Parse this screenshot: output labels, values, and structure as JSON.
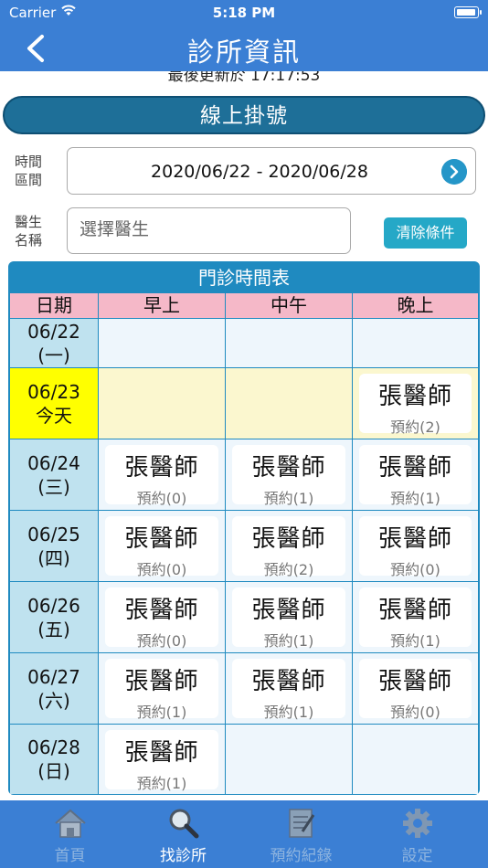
{
  "status_bar": {
    "carrier": "Carrier",
    "time": "5:18 PM"
  },
  "nav": {
    "title": "診所資訊"
  },
  "last_updated": "最後更新於 17:17:53",
  "banner": "線上掛號",
  "filters": {
    "period_label": "時間\n區間",
    "period_value": "2020/06/22 - 2020/06/28",
    "doctor_label": "醫生\n名稱",
    "doctor_placeholder": "選擇醫生",
    "clear_label": "清除條件"
  },
  "schedule": {
    "title": "門診時間表",
    "headers": [
      "日期",
      "早上",
      "中午",
      "晚上"
    ],
    "rows": [
      {
        "date": "06/22",
        "day": "(一)",
        "slots": [
          null,
          null,
          null
        ]
      },
      {
        "date": "06/23",
        "day": "今天",
        "today": true,
        "slots": [
          null,
          null,
          {
            "doctor": "張醫師",
            "booked": "預約(2)"
          }
        ]
      },
      {
        "date": "06/24",
        "day": "(三)",
        "slots": [
          {
            "doctor": "張醫師",
            "booked": "預約(0)"
          },
          {
            "doctor": "張醫師",
            "booked": "預約(1)"
          },
          {
            "doctor": "張醫師",
            "booked": "預約(1)"
          }
        ]
      },
      {
        "date": "06/25",
        "day": "(四)",
        "slots": [
          {
            "doctor": "張醫師",
            "booked": "預約(0)"
          },
          {
            "doctor": "張醫師",
            "booked": "預約(2)"
          },
          {
            "doctor": "張醫師",
            "booked": "預約(0)"
          }
        ]
      },
      {
        "date": "06/26",
        "day": "(五)",
        "slots": [
          {
            "doctor": "張醫師",
            "booked": "預約(0)"
          },
          {
            "doctor": "張醫師",
            "booked": "預約(1)"
          },
          {
            "doctor": "張醫師",
            "booked": "預約(1)"
          }
        ]
      },
      {
        "date": "06/27",
        "day": "(六)",
        "slots": [
          {
            "doctor": "張醫師",
            "booked": "預約(1)"
          },
          {
            "doctor": "張醫師",
            "booked": "預約(1)"
          },
          {
            "doctor": "張醫師",
            "booked": "預約(0)"
          }
        ]
      },
      {
        "date": "06/28",
        "day": "(日)",
        "slots": [
          {
            "doctor": "張醫師",
            "booked": "預約(1)"
          },
          null,
          null
        ]
      }
    ]
  },
  "tabs": [
    {
      "label": "首頁",
      "icon": "home-icon"
    },
    {
      "label": "找診所",
      "icon": "search-icon",
      "active": true
    },
    {
      "label": "預約紀錄",
      "icon": "notepad-icon"
    },
    {
      "label": "設定",
      "icon": "gear-icon"
    }
  ],
  "colors": {
    "primary": "#3b7fd4",
    "banner": "#1e6f98",
    "header_pink": "#f5b8c8",
    "today_yellow": "#ffff00"
  }
}
